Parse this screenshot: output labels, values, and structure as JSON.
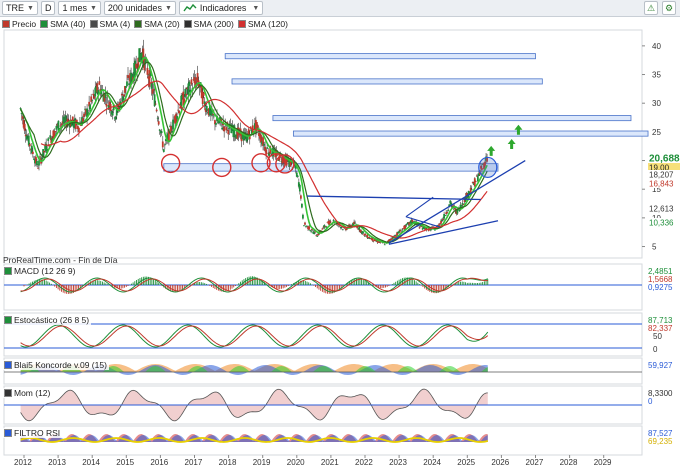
{
  "toolbar": {
    "symbol": "TRE",
    "period_short": "D",
    "timeframe": "1 mes",
    "units": "200 unidades",
    "indicators": "Indicadores"
  },
  "legend": [
    {
      "label": "Precio",
      "color": "#c0392b"
    },
    {
      "label": "SMA (40)",
      "color": "#1e8f3a"
    },
    {
      "label": "SMA (4)",
      "color": "#4a4a4a"
    },
    {
      "label": "SMA (20)",
      "color": "#2e6b1e"
    },
    {
      "label": "SMA (200)",
      "color": "#2f2f2f"
    },
    {
      "label": "SMA (120)",
      "color": "#d23030"
    }
  ],
  "credit": "ProRealTime.com - Fin de Día",
  "price_axis": {
    "ticks": [
      "40",
      "35",
      "30",
      "25",
      "20",
      "15",
      "10",
      "5"
    ],
    "badges": [
      {
        "text": "20,688",
        "color": "#1e8f3a",
        "bg": "#ffffff"
      },
      {
        "text": "19,00",
        "color": "#222222",
        "bg": "#f7e07a"
      },
      {
        "text": "18,207",
        "color": "#333333",
        "bg": "#ffffff"
      },
      {
        "text": "16,843",
        "color": "#c0392b",
        "bg": "#ffffff"
      },
      {
        "text": "12,613",
        "color": "#333333",
        "bg": "#ffffff"
      },
      {
        "text": "10,336",
        "color": "#1e8f3a",
        "bg": "#ffffff"
      }
    ]
  },
  "x_axis": [
    "2012",
    "2013",
    "2014",
    "2015",
    "2016",
    "2017",
    "2018",
    "2019",
    "2020",
    "2021",
    "2022",
    "2023",
    "2024",
    "2025",
    "2026",
    "2027",
    "2028",
    "2029"
  ],
  "panes": [
    {
      "label": "MACD (12 26 9)",
      "values": [
        "2,4851",
        "1,5668",
        "0,9275"
      ],
      "colors": [
        "#1e8f3a",
        "#c0392b",
        "#2a5bd7"
      ]
    },
    {
      "label": "Estocástico (26 8 5)",
      "values": [
        "87,713",
        "82,337"
      ],
      "colors": [
        "#1e8f3a",
        "#c0392b"
      ],
      "ticks": [
        "50",
        "0"
      ]
    },
    {
      "label": "Blai5 Koncorde v.09 (15)",
      "values": [
        "59,927"
      ],
      "colors": [
        "#2a5bd7"
      ]
    },
    {
      "label": "Mom (12)",
      "values": [
        "8,3300",
        "0"
      ],
      "colors": [
        "#333333",
        "#2a5bd7"
      ]
    },
    {
      "label": "FILTRO RSI",
      "values": [
        "87,527",
        "69,235"
      ],
      "colors": [
        "#2a5bd7",
        "#d4b000"
      ]
    }
  ]
}
